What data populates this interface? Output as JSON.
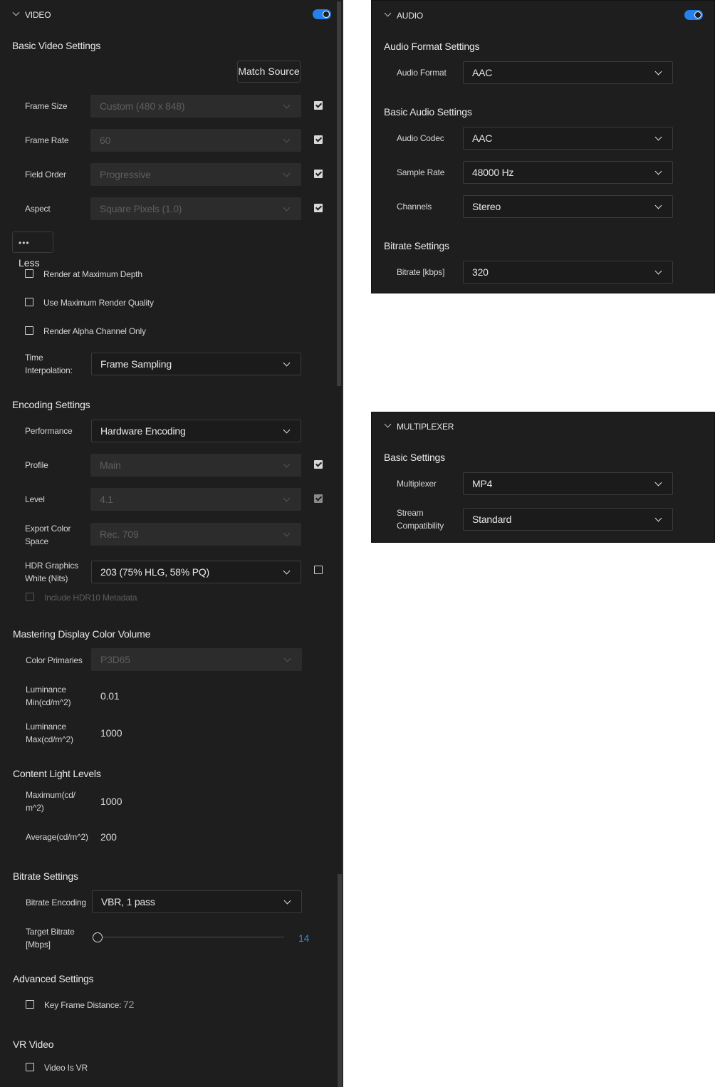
{
  "video": {
    "header": "VIDEO",
    "basic_title": "Basic Video Settings",
    "match_source": "Match Source",
    "frame_size": {
      "label": "Frame Size",
      "value": "Custom (480 x 848)"
    },
    "frame_rate": {
      "label": "Frame Rate",
      "value": "60"
    },
    "field_order": {
      "label": "Field Order",
      "value": "Progressive"
    },
    "aspect": {
      "label": "Aspect",
      "value": "Square Pixels (1.0)"
    },
    "less_button": "Less",
    "render_max_depth": "Render at Maximum Depth",
    "max_render_quality": "Use Maximum Render Quality",
    "render_alpha": "Render Alpha Channel Only",
    "time_interp": {
      "label_line1": "Time",
      "label_line2": "Interpolation:",
      "value": "Frame Sampling"
    },
    "encoding_title": "Encoding Settings",
    "performance": {
      "label": "Performance",
      "value": "Hardware Encoding"
    },
    "profile": {
      "label": "Profile",
      "value": "Main"
    },
    "level": {
      "label": "Level",
      "value": "4.1"
    },
    "export_color": {
      "label_line1": "Export Color",
      "label_line2": "Space",
      "value": "Rec. 709"
    },
    "hdr_white": {
      "label_line1": "HDR Graphics",
      "label_line2": "White (Nits)",
      "value": "203 (75% HLG, 58% PQ)"
    },
    "hdr10_meta": "Include HDR10 Metadata",
    "mastering_title": "Mastering Display Color Volume",
    "color_primaries": {
      "label": "Color Primaries",
      "value": "P3D65"
    },
    "lum_min": {
      "label_line1": "Luminance",
      "label_line2": "Min(cd/m^2)",
      "value": "0.01"
    },
    "lum_max": {
      "label_line1": "Luminance",
      "label_line2": "Max(cd/m^2)",
      "value": "1000"
    },
    "cll_title": "Content Light Levels",
    "cll_max": {
      "label_line1": "Maximum(cd/",
      "label_line2": "m^2)",
      "value": "1000"
    },
    "cll_avg": {
      "label": "Average(cd/m^2)",
      "value": "200"
    },
    "bitrate_title": "Bitrate Settings",
    "bitrate_encoding": {
      "label": "Bitrate Encoding",
      "value": "VBR, 1 pass"
    },
    "target_bitrate": {
      "label_line1": "Target Bitrate",
      "label_line2": "[Mbps]",
      "value": "14",
      "slider_fraction": 0.0
    },
    "advanced_title": "Advanced Settings",
    "keyframe": {
      "label": "Key Frame Distance:",
      "value": "72"
    },
    "vr_title": "VR Video",
    "video_is_vr": "Video Is VR"
  },
  "audio": {
    "header": "AUDIO",
    "format_title": "Audio Format Settings",
    "audio_format": {
      "label": "Audio Format",
      "value": "AAC"
    },
    "basic_title": "Basic Audio Settings",
    "codec": {
      "label": "Audio Codec",
      "value": "AAC"
    },
    "sample_rate": {
      "label": "Sample Rate",
      "value": "48000 Hz"
    },
    "channels": {
      "label": "Channels",
      "value": "Stereo"
    },
    "bitrate_title": "Bitrate Settings",
    "bitrate": {
      "label": "Bitrate [kbps]",
      "value": "320"
    }
  },
  "multiplexer": {
    "header": "MULTIPLEXER",
    "basic_title": "Basic Settings",
    "mux": {
      "label": "Multiplexer",
      "value": "MP4"
    },
    "stream": {
      "label_line1": "Stream",
      "label_line2": "Compatibility",
      "value": "Standard"
    }
  },
  "colors": {
    "accent": "#2680eb",
    "panel": "#1e1e1e"
  }
}
